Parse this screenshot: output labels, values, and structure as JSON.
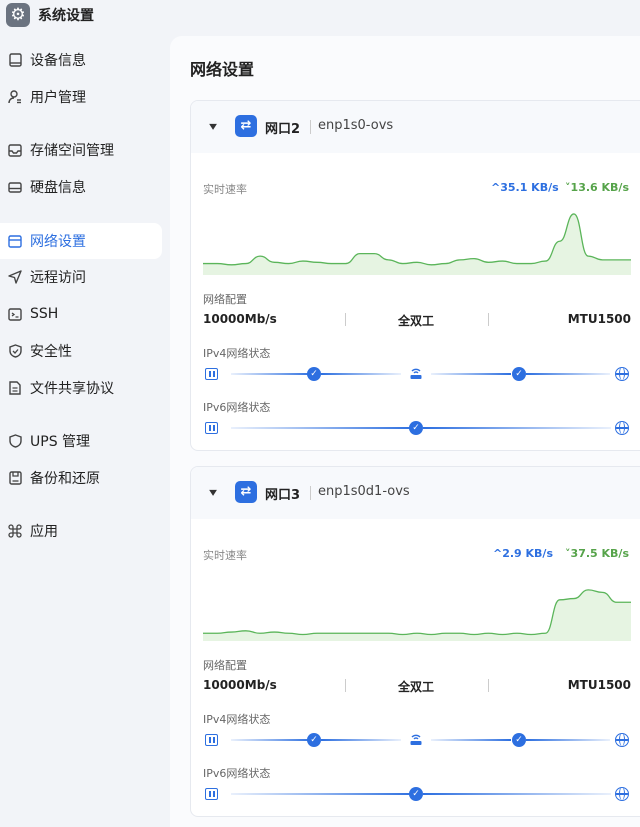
{
  "app": {
    "title": "系统设置",
    "icon": "gear-icon"
  },
  "sidebar": {
    "items": [
      {
        "label": "设备信息",
        "icon": "device-icon",
        "active": false
      },
      {
        "label": "用户管理",
        "icon": "user-icon",
        "active": false
      },
      {
        "label": "存储空间管理",
        "icon": "storage-icon",
        "active": false
      },
      {
        "label": "硬盘信息",
        "icon": "disk-icon",
        "active": false
      },
      {
        "label": "网络设置",
        "icon": "network-icon",
        "active": true
      },
      {
        "label": "远程访问",
        "icon": "send-icon",
        "active": false
      },
      {
        "label": "SSH",
        "icon": "terminal-icon",
        "active": false
      },
      {
        "label": "安全性",
        "icon": "shield-check-icon",
        "active": false
      },
      {
        "label": "文件共享协议",
        "icon": "file-icon",
        "active": false
      },
      {
        "label": "UPS 管理",
        "icon": "shield-icon",
        "active": false
      },
      {
        "label": "备份和还原",
        "icon": "backup-icon",
        "active": false
      },
      {
        "label": "应用",
        "icon": "apps-icon",
        "active": false
      }
    ]
  },
  "main": {
    "title": "网络设置",
    "ports": [
      {
        "name": "网口2",
        "device": "enp1s0-ovs",
        "realtime_label": "实时速率",
        "upload": "^35.1 KB/s",
        "download": "˅13.6 KB/s",
        "config_label": "网络配置",
        "speed": "10000Mb/s",
        "duplex": "全双工",
        "mtu": "MTU1500",
        "ipv4_label": "IPv4网络状态",
        "ipv6_label": "IPv6网络状态",
        "traffic": [
          6,
          6,
          5,
          6,
          12,
          7,
          6,
          8,
          7,
          6,
          6,
          14,
          14,
          9,
          6,
          7,
          5,
          6,
          9,
          10,
          7,
          8,
          6,
          6,
          8,
          24,
          46,
          12,
          9,
          9,
          9
        ]
      },
      {
        "name": "网口3",
        "device": "enp1s0d1-ovs",
        "realtime_label": "实时速率",
        "upload": "^2.9 KB/s",
        "download": "˅37.5 KB/s",
        "config_label": "网络配置",
        "speed": "10000Mb/s",
        "duplex": "全双工",
        "mtu": "MTU1500",
        "ipv4_label": "IPv4网络状态",
        "ipv6_label": "IPv6网络状态",
        "traffic": [
          3,
          3,
          4,
          5,
          3,
          4,
          3,
          2,
          3,
          3,
          3,
          3,
          3,
          3,
          2,
          3,
          2,
          3,
          3,
          2,
          3,
          2,
          3,
          2,
          3,
          30,
          31,
          38,
          36,
          28,
          28
        ]
      }
    ]
  },
  "colors": {
    "accent": "#2d6fe0",
    "download": "#56a34a",
    "chart_line": "#5bb55a",
    "chart_fill": "#e6f4e2"
  }
}
